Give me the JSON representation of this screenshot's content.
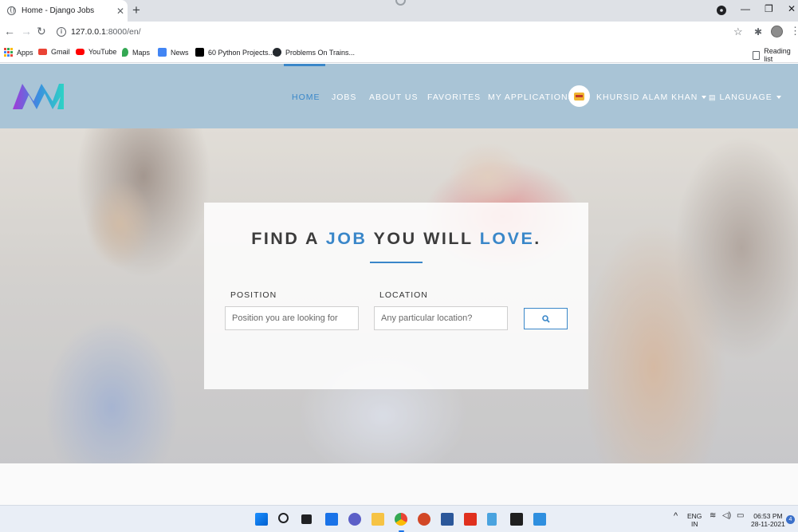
{
  "browser": {
    "tab_title": "Home - Django Jobs",
    "url_host": "127.0.0.1",
    "url_path": ":8000/en/",
    "bookmarks": [
      {
        "label": "Apps",
        "icon": "apps-grid-icon"
      },
      {
        "label": "Gmail",
        "icon": "gmail-icon"
      },
      {
        "label": "YouTube",
        "icon": "youtube-icon"
      },
      {
        "label": "Maps",
        "icon": "maps-icon"
      },
      {
        "label": "News",
        "icon": "news-icon"
      },
      {
        "label": "60 Python Projects...",
        "icon": "medium-icon"
      },
      {
        "label": "Problems On Trains...",
        "icon": "github-icon"
      }
    ],
    "reading_list": "Reading list"
  },
  "nav": {
    "items": [
      "HOME",
      "JOBS",
      "ABOUT US",
      "FAVORITES",
      "MY APPLICATIONS"
    ],
    "active": "HOME",
    "user_name": "KHURSID ALAM KHAN",
    "language": "LANGUAGE"
  },
  "search": {
    "headline_1": "FIND A ",
    "headline_2": "JOB",
    "headline_3": " YOU WILL ",
    "headline_4": "LOVE",
    "headline_5": ".",
    "position_label": "POSITION",
    "position_placeholder": "Position you are looking for",
    "location_label": "LOCATION",
    "location_placeholder": "Any particular location?"
  },
  "taskbar": {
    "lang_1": "ENG",
    "lang_2": "IN",
    "time": "06:53 PM",
    "date": "28-11-2021",
    "notification_count": "4"
  },
  "colors": {
    "accent": "#3a87c9",
    "navbar_bg": "#a9c4d6"
  }
}
